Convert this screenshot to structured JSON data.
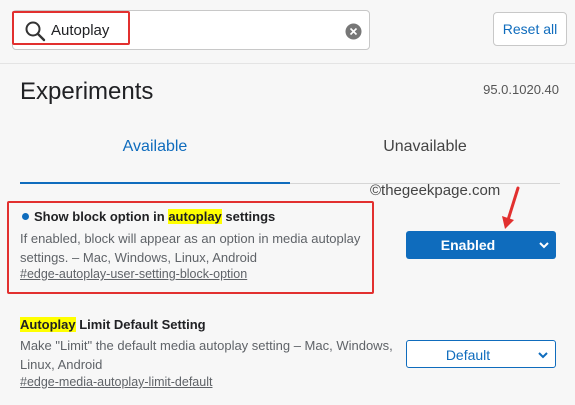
{
  "search": {
    "value": "Autoplay"
  },
  "toolbar": {
    "reset_label": "Reset all"
  },
  "header": {
    "title": "Experiments",
    "version": "95.0.1020.40"
  },
  "tabs": [
    {
      "label": "Available",
      "active": true
    },
    {
      "label": "Unavailable",
      "active": false
    }
  ],
  "watermark": "©thegeekpage.com",
  "experiments": [
    {
      "title_before": "Show block option in ",
      "title_highlight": "autoplay",
      "title_after": " settings",
      "description_line1": "If enabled, block will appear as an option in media autoplay",
      "description_line2": "settings. – Mac, Windows, Linux, Android",
      "link": "#edge-autoplay-user-setting-block-option",
      "selected": "Enabled"
    },
    {
      "title_highlight": "Autoplay",
      "title_after": " Limit Default Setting",
      "description_line1": "Make \"Limit\" the default media autoplay setting – Mac, Windows,",
      "description_line2": "Linux, Android",
      "link": "#edge-media-autoplay-limit-default",
      "selected": "Default"
    }
  ],
  "colors": {
    "accent": "#0f6cbd",
    "highlight": "#ffff00",
    "annotation": "#e2302f"
  },
  "icons": [
    "search-icon",
    "clear-icon",
    "chevron-down-icon",
    "annotation-arrow-icon"
  ]
}
